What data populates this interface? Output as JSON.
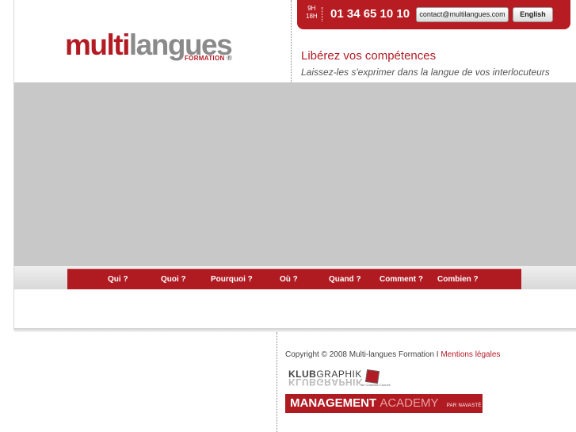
{
  "header": {
    "logo": {
      "part1": "multi",
      "part2": "langues",
      "sub": "FORMATION",
      "reg": "®"
    },
    "hours": {
      "start": "9H",
      "end": "18H"
    },
    "phone": "01 34 65 10 10",
    "email_button": "contact@multilangues.com",
    "language_button": "English",
    "tagline": "Libérez vos compétences",
    "subtagline": "Laissez-les s'exprimer dans la langue de vos interlocuteurs"
  },
  "nav": {
    "items": [
      "Qui ?",
      "Quoi ?",
      "Pourquoi ?",
      "Où ?",
      "Quand ?",
      "Comment ?",
      "Combien ?"
    ]
  },
  "footer": {
    "copyright": "Copyright © 2008 Multi-langues Formation I",
    "legal_link": "Mentions légales",
    "klub": {
      "bold": "KLUB",
      "rest": "GRAPHIK",
      "caption": "de Charlotte Connell"
    },
    "management": {
      "bold": "MANAGEMENT",
      "light": "ACADEMY",
      "tail": "PAR NAVASTÉ TRAINING PARTNERS"
    }
  },
  "colors": {
    "brand_red": "#b31b24",
    "banner_gray": "#c8c8c8"
  }
}
